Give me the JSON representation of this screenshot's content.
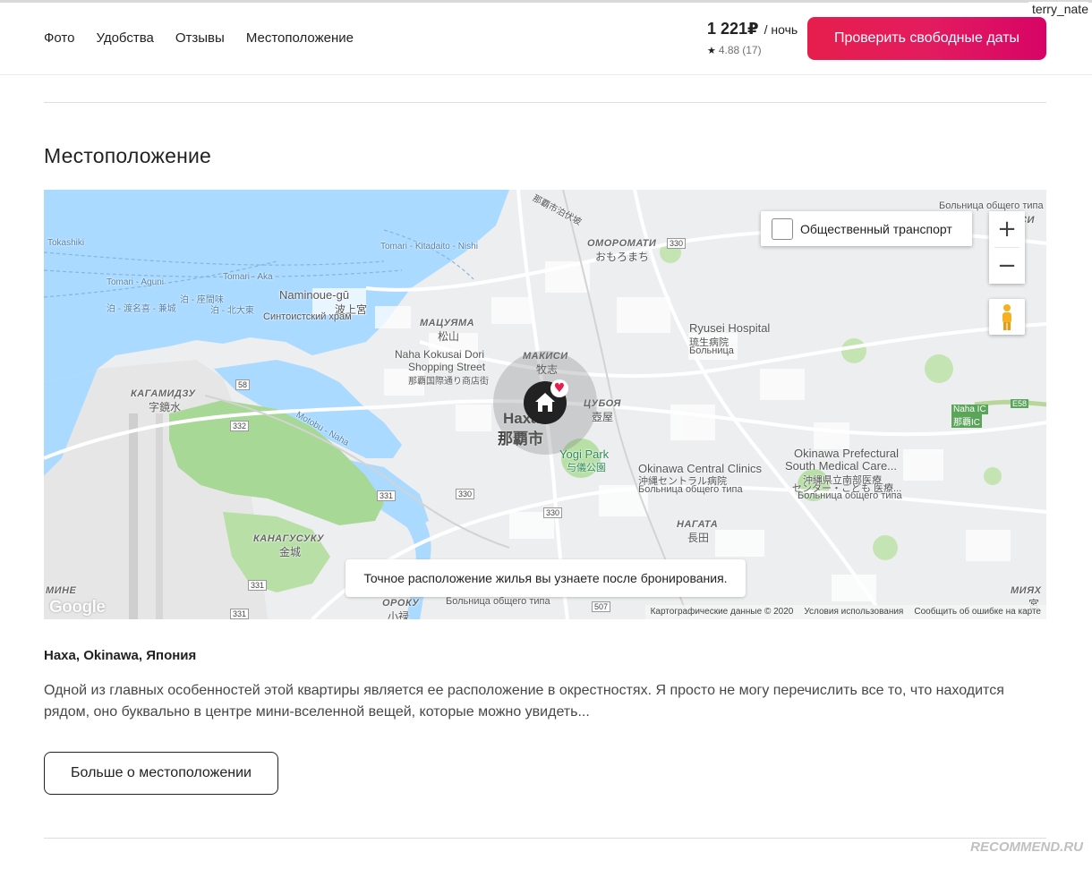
{
  "user": {
    "name": "terry_nate"
  },
  "nav": {
    "items": [
      "Фото",
      "Удобства",
      "Отзывы",
      "Местоположение"
    ]
  },
  "booking": {
    "price": "1 221₽",
    "per_night": "/ ночь",
    "rating": "4.88",
    "reviews_count": "(17)",
    "cta_label": "Проверить свободные даты",
    "cta_color": "#e31c5f"
  },
  "section": {
    "title": "Местоположение"
  },
  "map": {
    "transit_label": "Общественный транспорт",
    "transit_checked": false,
    "zoom_in": "+",
    "zoom_out": "−",
    "notice": "Точное расположение жилья вы узнаете после бронирования.",
    "google_logo": "Google",
    "attribution": {
      "data": "Картографические данные © 2020",
      "terms": "Условия использования",
      "report": "Сообщить об ошибке на карте"
    },
    "labels": {
      "tokashiki": "Tokashiki",
      "tomari_aguni": "Tomari - Aguni",
      "tomari_aka": "Tomari - Aka",
      "tomari_kitadaito": "Tomari - Kitadaito - Nishi",
      "jp_route1": "泊 - 渡名喜 - 兼城",
      "jp_route2": "泊 - 座間味",
      "jp_route3": "泊 - 北大東",
      "naminoue_en": "Naminoue-gū",
      "naminoue_jp": "波上宮",
      "naminoue_ru": "Синтоистский храм",
      "matsuyama_ru": "МАЦУЯМА",
      "matsuyama_jp": "松山",
      "kokusai_en1": "Naha Kokusai Dori",
      "kokusai_en2": "Shopping Street",
      "kokusai_jp": "那覇国際通り商店街",
      "makishi_ru": "МАКИСИ",
      "makishi_jp": "牧志",
      "omoromachi_ru": "ОМОРОМАТИ",
      "omoromachi_jp": "おもろまち",
      "ryusei_en": "Ryusei Hospital",
      "ryusei_jp": "琉生病院",
      "ryusei_ru": "Больница",
      "kagamizu_ru": "КАГАМИДЗУ",
      "kagamizu_jp": "字鏡水",
      "naha_ru": "Наха",
      "naha_jp": "那覇市",
      "tsuboya_ru": "ЦУБОЯ",
      "tsuboya_jp": "壺屋",
      "yogi_en": "Yogi Park",
      "yogi_jp": "与儀公園",
      "clinics_en": "Okinawa Central Clinics",
      "clinics_jp": "沖縄セントラル病院",
      "clinics_ru": "Больница общего типа",
      "prefectural_en1": "Okinawa Prefectural",
      "prefectural_en2": "South Medical Care...",
      "prefectural_jp1": "沖縄県立南部医療",
      "prefectural_jp2": "センター・こども 医療...",
      "prefectural_ru": "Больница общего типа",
      "nagata_ru": "НАГАТА",
      "nagata_jp": "長田",
      "kanagusuku_ru": "КАНАГУСУКУ",
      "kanagusuku_jp": "金城",
      "motobu": "Motobu - Naha",
      "naha_ic_en": "Naha IC",
      "naha_ic_jp": "那覇IC",
      "oroku_ru": "ОРОКУ",
      "oroku_jp": "小禄",
      "oroku_hosp": "Больница общего типа",
      "miyagi_ru": "МИЯХ",
      "miyagi_jp": "宮",
      "mine_ru": "МИНЕ",
      "shimo_ru": "СИ",
      "hosp_top": "Больница общего типа",
      "jp_top": "那覇市泊伏坡",
      "r58": "58",
      "r330": "330",
      "r332": "332",
      "r331": "331",
      "r507": "507",
      "e58": "E58"
    }
  },
  "location": {
    "address": "Наха, Okinawa, Япония",
    "description": "Одной из главных особенностей этой квартиры является ее расположение в окрестностях. Я просто не могу перечислить все то, что находится рядом, оно буквально в центре мини-вселенной вещей, которые можно увидеть...",
    "more_label": "Больше о местоположении"
  },
  "watermark": "RECOMMEND.RU"
}
